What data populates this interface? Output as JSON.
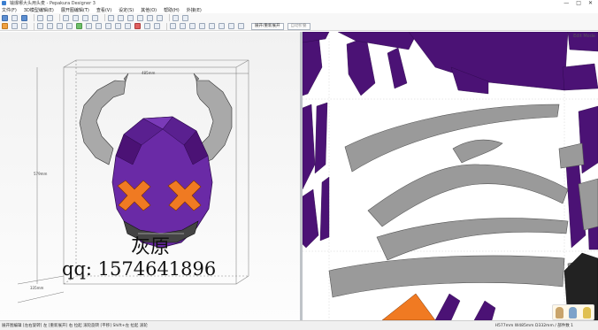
{
  "app": {
    "title": "输爆哪大头用头麦 - Pepakura Designer 3",
    "window_buttons": [
      "—",
      "□",
      "✕"
    ]
  },
  "menu": [
    "文件(F)",
    "3D模型编辑(E)",
    "展开图编辑(T)",
    "查看(V)",
    "设定(S)",
    "其他(O)",
    "帮助(H)",
    "外接(E)"
  ],
  "toolbar": {
    "btn_a": "展开/重新展开",
    "btn_b": "自动折叠"
  },
  "view3d": {
    "dim_width": "485mm",
    "dim_height": "579mm",
    "dim_depth": "335mm"
  },
  "watermark": {
    "name": "灰原",
    "qq": "qq: 1574641896"
  },
  "view2d": {
    "mode_label": "Edit Mode"
  },
  "statusbar": {
    "left": "展开图编辑 [左右旋转] 左 [重新展开] 右 拉起 滚轮旋转 [平移] Shift+左 拉起 滚轮",
    "right": "H577mm W485mm D332mm / 部件数 1"
  },
  "colors": {
    "purple": "#4b1275",
    "purple_mid": "#6a2aa6",
    "orange": "#f07a22",
    "horn_gray": "#a9a9a9",
    "part_gray": "#9a9a9a",
    "window_bg": "#ffffff"
  },
  "icons": [
    "app-icon",
    "new-icon",
    "open-icon",
    "save-icon",
    "print-icon",
    "undo-icon",
    "redo-icon",
    "zoom-icon",
    "rotate-icon",
    "select-icon",
    "cut-icon",
    "join-icon",
    "fold-icon",
    "texture-icon"
  ]
}
